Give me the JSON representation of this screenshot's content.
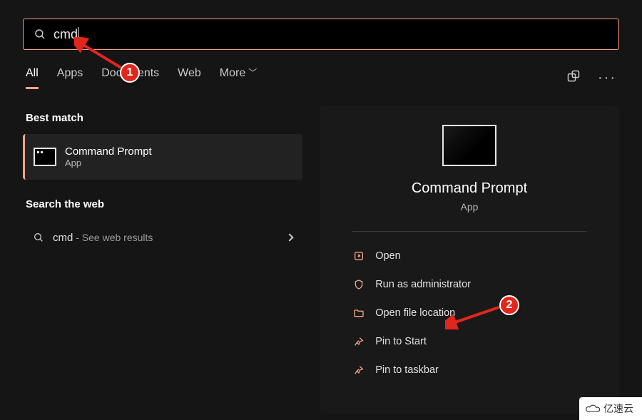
{
  "search": {
    "query": "cmd"
  },
  "tabs": {
    "all": "All",
    "apps": "Apps",
    "documents": "Documents",
    "web": "Web",
    "more": "More"
  },
  "left": {
    "best_heading": "Best match",
    "best_title": "Command Prompt",
    "best_sub": "App",
    "web_heading": "Search the web",
    "web_term": "cmd",
    "web_suffix": " - See web results"
  },
  "preview": {
    "title": "Command Prompt",
    "subtitle": "App",
    "open": "Open",
    "admin": "Run as administrator",
    "file_loc": "Open file location",
    "pin_start": "Pin to Start",
    "pin_taskbar": "Pin to taskbar"
  },
  "annot": {
    "b1": "1",
    "b2": "2"
  },
  "watermark": "亿速云"
}
